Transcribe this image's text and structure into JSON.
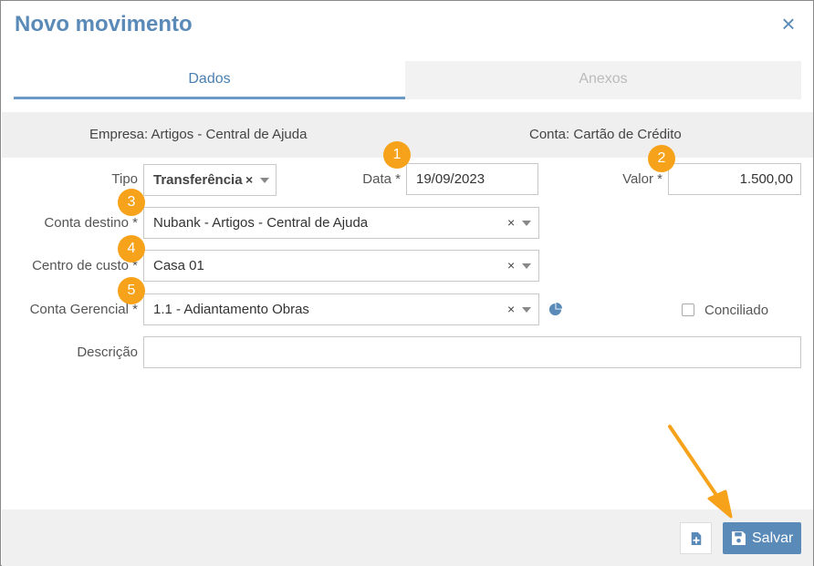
{
  "dialog": {
    "title": "Novo movimento",
    "close_icon": "close-icon"
  },
  "tabs": [
    {
      "label": "Dados",
      "active": true
    },
    {
      "label": "Anexos",
      "active": false
    }
  ],
  "info": {
    "empresa": "Empresa: Artigos - Central de Ajuda",
    "conta": "Conta: Cartão de Crédito"
  },
  "form": {
    "tipo": {
      "label": "Tipo",
      "value": "Transferência",
      "clear": "×"
    },
    "data": {
      "label": "Data *",
      "value": "19/09/2023"
    },
    "valor": {
      "label": "Valor *",
      "value": "1.500,00"
    },
    "conta_destino": {
      "label": "Conta destino *",
      "value": "Nubank - Artigos - Central de Ajuda",
      "clear": "×"
    },
    "centro_custo": {
      "label": "Centro de custo *",
      "value": "Casa 01",
      "clear": "×"
    },
    "conta_gerencial": {
      "label": "Conta Gerencial *",
      "value": "1.1 - Adiantamento Obras",
      "clear": "×"
    },
    "conciliado": {
      "label": "Conciliado",
      "checked": false
    },
    "descricao": {
      "label": "Descrição",
      "value": ""
    }
  },
  "badges": [
    "1",
    "2",
    "3",
    "4",
    "5"
  ],
  "footer": {
    "save_label": "Salvar"
  },
  "colors": {
    "accent": "#5a8ab8",
    "badge": "#f7a21b",
    "arrow": "#f7a21b"
  }
}
